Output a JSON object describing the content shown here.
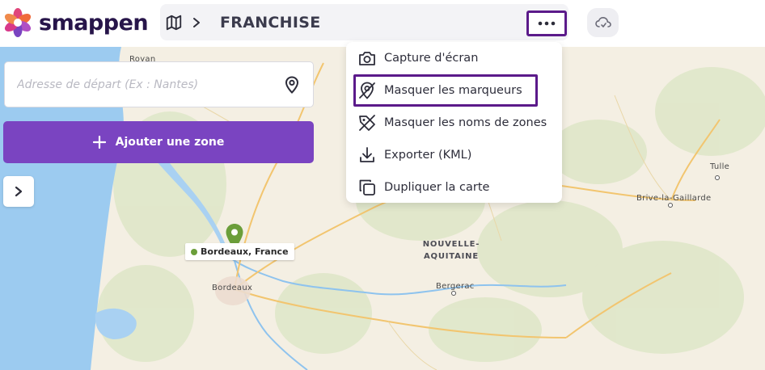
{
  "brand": {
    "name": "smappen"
  },
  "header": {
    "breadcrumb_title": "FRANCHISE",
    "more_icon": "more-horizontal-icon",
    "cloud_icon": "cloud-sync-icon"
  },
  "search": {
    "placeholder": "Adresse de départ (Ex : Nantes)",
    "value": ""
  },
  "add_zone": {
    "label": "Ajouter une zone"
  },
  "menu": {
    "items": [
      {
        "label": "Capture d'écran",
        "icon": "camera-icon"
      },
      {
        "label": "Masquer les marqueurs",
        "icon": "marker-off-icon"
      },
      {
        "label": "Masquer les noms de zones",
        "icon": "tag-off-icon"
      },
      {
        "label": "Exporter (KML)",
        "icon": "download-icon"
      },
      {
        "label": "Dupliquer la carte",
        "icon": "copy-icon"
      }
    ]
  },
  "map": {
    "place_label": "Bordeaux, France",
    "labels": {
      "tulle": "Tulle",
      "brive": "Brive-la-Gaillarde",
      "bergerac": "Bergerac",
      "region_line1": "NOUVELLE-",
      "region_line2": "AQUITAINE",
      "royan": "Royan",
      "bordeaux": "Bordeaux"
    }
  },
  "colors": {
    "accent": "#7a44c1",
    "highlight_border": "#5b1a8a",
    "brand_dark": "#27154a",
    "pin_green": "#6b9e3a",
    "sea": "#9ccbf0"
  }
}
